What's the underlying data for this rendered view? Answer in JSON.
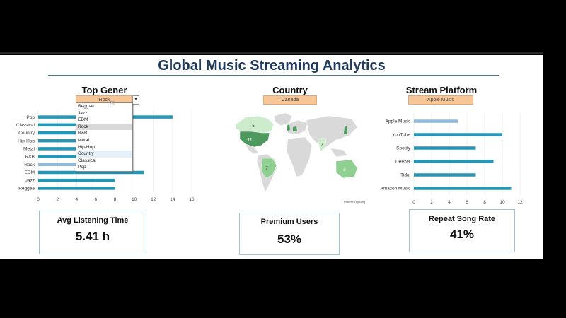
{
  "dashboard": {
    "title": "Global Music Streaming Analytics"
  },
  "genre": {
    "header": "Top Gener",
    "selected": "Rock",
    "dropdown_arrow": "▾",
    "options": [
      "Reggae",
      "Jazz",
      "EDM",
      "Rock",
      "R&B",
      "Metal",
      "Hip-Hop",
      "Country",
      "Classical",
      "Pop"
    ],
    "selected_index": 3,
    "hover_index": 7
  },
  "country": {
    "header": "Country",
    "selected": "Canada",
    "map_labels": [
      "5",
      "11",
      "7",
      "7",
      "8"
    ],
    "attribution": "Powered by Bing",
    "colors": {
      "dark": "#4e9a5e",
      "mid": "#8fcf8f",
      "light": "#cdeccb",
      "land": "#d9d9d9"
    }
  },
  "platform": {
    "header": "Stream Platform",
    "selected": "Apple Music"
  },
  "chart_data": [
    {
      "type": "bar",
      "orientation": "horizontal",
      "categories": [
        "Pop",
        "Classical",
        "Country",
        "Hip-Hop",
        "Metal",
        "R&B",
        "Rock",
        "EDM",
        "Jazz",
        "Reggae"
      ],
      "values": [
        14,
        8,
        8,
        8,
        8,
        8,
        8,
        11,
        8,
        8
      ],
      "highlight": "Rock",
      "xlim": [
        0,
        16
      ],
      "xticks": [
        "0",
        "2",
        "4",
        "6",
        "8",
        "10",
        "12",
        "14",
        "16"
      ],
      "bar_color": "#2596b4",
      "highlight_color": "#8fbcdc"
    },
    {
      "type": "bar",
      "orientation": "horizontal",
      "categories": [
        "Apple Music",
        "YouTube",
        "Spotify",
        "Deezer",
        "Tidal",
        "Amazon Music"
      ],
      "values": [
        5,
        10,
        7,
        9,
        7,
        11
      ],
      "highlight": "Apple Music",
      "xlim": [
        0,
        12
      ],
      "xticks": [
        "0",
        "2",
        "4",
        "6",
        "8",
        "10",
        "12"
      ],
      "bar_color": "#2596b4",
      "highlight_color": "#8fbcdc"
    }
  ],
  "kpis": [
    {
      "label": "Avg Listening Time",
      "value": "5.41 h"
    },
    {
      "label": "Premium Users",
      "value": "53%"
    },
    {
      "label": "Repeat Song Rate",
      "value": "41%"
    }
  ]
}
